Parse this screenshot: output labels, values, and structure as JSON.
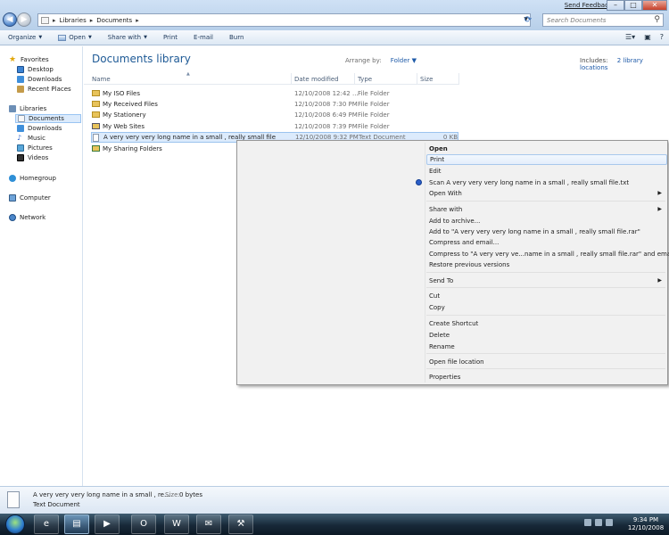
{
  "titlebar": {
    "feedback_link": "Send Feedback",
    "minimize": "–",
    "maximize": "□",
    "close": "✕"
  },
  "address": {
    "segments": [
      "Libraries",
      "Documents"
    ],
    "search_placeholder": "Search Documents"
  },
  "toolbar": {
    "organize": "Organize",
    "open": "Open",
    "share_with": "Share with",
    "print": "Print",
    "email": "E-mail",
    "burn": "Burn"
  },
  "nav": {
    "favorites": "Favorites",
    "desktop": "Desktop",
    "downloads": "Downloads",
    "recent_places": "Recent Places",
    "libraries": "Libraries",
    "documents": "Documents",
    "lib_downloads": "Downloads",
    "music": "Music",
    "pictures": "Pictures",
    "videos": "Videos",
    "homegroup": "Homegroup",
    "computer": "Computer",
    "network": "Network"
  },
  "library": {
    "title": "Documents library",
    "arrange_label": "Arrange by:",
    "arrange_value": "Folder",
    "includes_label": "Includes:",
    "includes_link": "2 library locations"
  },
  "columns": {
    "name": "Name",
    "date": "Date modified",
    "type": "Type",
    "size": "Size"
  },
  "files": [
    {
      "name": "My ISO Files",
      "date": "12/10/2008 12:42 ...",
      "type": "File Folder",
      "size": ""
    },
    {
      "name": "My Received Files",
      "date": "12/10/2008 7:30 PM",
      "type": "File Folder",
      "size": ""
    },
    {
      "name": "My Stationery",
      "date": "12/10/2008 6:49 PM",
      "type": "File Folder",
      "size": ""
    },
    {
      "name": "My Web Sites",
      "date": "12/10/2008 7:39 PM",
      "type": "File Folder",
      "size": ""
    },
    {
      "name": "A very very very long name in a small , really small file",
      "date": "12/10/2008 9:32 PM",
      "type": "Text Document",
      "size": "0 KB"
    },
    {
      "name": "My Sharing Folders",
      "date": "",
      "type": "",
      "size": ""
    }
  ],
  "menu": {
    "open": "Open",
    "print": "Print",
    "edit": "Edit",
    "scan": "Scan A very very very long name in a small , really small file.txt",
    "open_with": "Open With",
    "share_with": "Share with",
    "add_archive": "Add to archive...",
    "add_rar": "Add to \"A very very very long name in a small , really small file.rar\"",
    "compress_email": "Compress and email...",
    "compress_rar_email": "Compress to \"A very very ve...name in a small , really small file.rar\" and email",
    "restore": "Restore previous versions",
    "send_to": "Send To",
    "cut": "Cut",
    "copy": "Copy",
    "create_shortcut": "Create Shortcut",
    "delete": "Delete",
    "rename": "Rename",
    "open_location": "Open file location",
    "properties": "Properties"
  },
  "details": {
    "name": "A very very very long name in a small , re...",
    "size_label": "Size:",
    "size_value": "0 bytes",
    "type": "Text Document"
  },
  "clock": {
    "time": "9:34 PM",
    "date": "12/10/2008"
  }
}
